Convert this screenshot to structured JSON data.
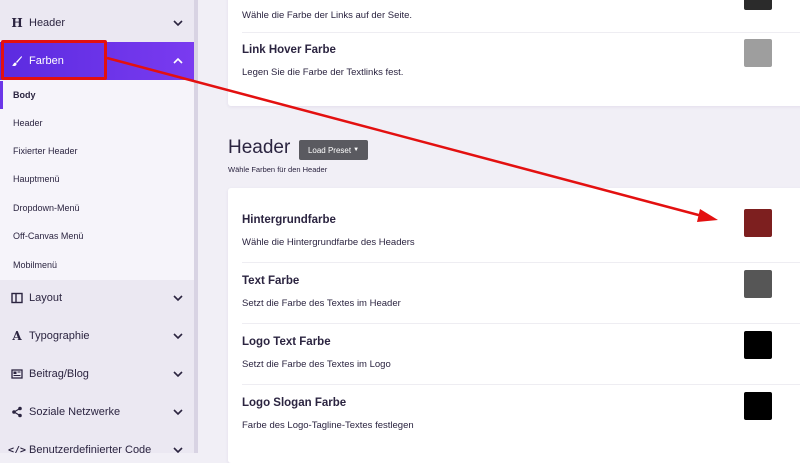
{
  "sidebar": {
    "items": [
      {
        "label": "Header",
        "icon": "heading-icon",
        "expanded": false
      },
      {
        "label": "Farben",
        "icon": "brush-icon",
        "expanded": true
      },
      {
        "label": "Layout",
        "icon": "layout-icon",
        "expanded": false
      },
      {
        "label": "Typographie",
        "icon": "font-icon",
        "expanded": false
      },
      {
        "label": "Beitrag/Blog",
        "icon": "newspaper-icon",
        "expanded": false
      },
      {
        "label": "Soziale Netzwerke",
        "icon": "share-icon",
        "expanded": false
      },
      {
        "label": "Benutzerdefinierter Code",
        "icon": "code-icon",
        "expanded": false
      }
    ],
    "subitems": [
      "Body",
      "Header",
      "Fixierter Header",
      "Hauptmenü",
      "Dropdown-Menü",
      "Off-Canvas Menü",
      "Mobilmenü"
    ],
    "active_subitem": "Body"
  },
  "top_card": {
    "rows": [
      {
        "title": "",
        "desc": "Wähle die Farbe der Links auf der Seite.",
        "color": "#2b2b2b"
      },
      {
        "title": "Link Hover Farbe",
        "desc": "Legen Sie die Farbe der Textlinks fest.",
        "color": "#9e9e9e"
      }
    ]
  },
  "header_section": {
    "title": "Header",
    "subtitle": "Wähle Farben für den Header",
    "preset_button": "Load Preset",
    "rows": [
      {
        "title": "Hintergrundfarbe",
        "desc": "Wähle die Hintergrundfarbe des Headers",
        "color": "#7d1f1f"
      },
      {
        "title": "Text Farbe",
        "desc": "Setzt die Farbe des Textes im Header",
        "color": "#565656"
      },
      {
        "title": "Logo Text Farbe",
        "desc": "Setzt die Farbe des Textes im Logo",
        "color": "#000000"
      },
      {
        "title": "Logo Slogan Farbe",
        "desc": "Farbe des Logo-Tagline-Textes festlegen",
        "color": "#000000"
      }
    ]
  },
  "colors": {
    "accent": "#6b36e8",
    "annotation": "#e31010"
  }
}
